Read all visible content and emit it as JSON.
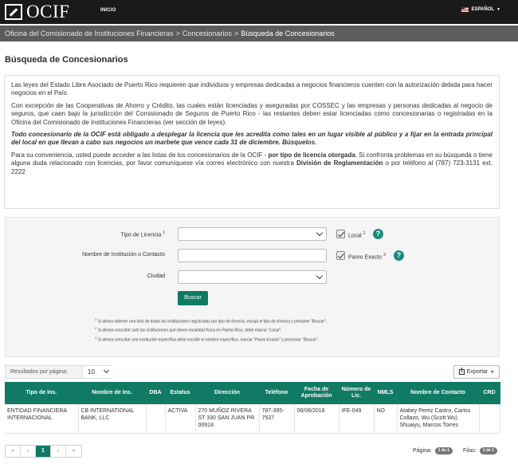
{
  "header": {
    "logo_text": "OCIF",
    "nav_home": "INICIO",
    "language": "ESPAÑOL"
  },
  "breadcrumb": {
    "items": [
      "Oficina del Comisionado de Instituciones Financieras",
      "Concesionarios"
    ],
    "current": "Búsqueda de Concesionarios",
    "separator": ">"
  },
  "page_title": "Búsqueda de Concesionarios",
  "info": {
    "p1": "Las leyes del Estado Libre Asociado de Puerto Rico requieren que individuos y empresas dedicadas a negocios financieros cuenten con la autorización debida para hacer negocios en el País.",
    "p2": "Con excepción de las Cooperativas de Ahorro y Crédito, las cuales están licenciadas y aseguradas por COSSEC y las empresas y personas dedicadas al negocio de seguros, que caen bajo la jurisdicción del Comisionado de Seguros de Puerto Rico - las restantes deben estar licenciadas como concesionarias o registradas en la Oficina del Comisionado de Instituciones Financieras (ver sección de leyes).",
    "p3": "Todo concesionario de la OCIF está obligado a desplegar la licencia que les acredita como tales en un lugar visible al público y a fijar en la entrada principal del local en que llevan a cabo sus negocios un marbete que vence cada 31 de diciembre. Búsquelos.",
    "p4a": "Para su conveniencia, usted puede acceder a las listas de los concesionarios de la OCIF - ",
    "p4b": "por tipo de licencia otorgada",
    "p4c": ". Si confronta problemas en su búsqueda o tiene alguna duda relacionado con licencias, por favor comuníquese vía correo electrónico con nuestra ",
    "p4d": "División de Reglamentación",
    "p4e": " o por teléfono al (787) 723-3131 ext. 2222"
  },
  "form": {
    "tipo_label": "Tipo de Licencia",
    "tipo_sup": "1",
    "tipo_value": "",
    "nombre_label": "Nombre de Institución o Contacto",
    "nombre_value": "",
    "ciudad_label": "Ciudad",
    "ciudad_value": "",
    "local_label": "Local",
    "local_sup": "2",
    "local_checked": true,
    "pareo_label": "Pareo Exacto",
    "pareo_sup": "3",
    "pareo_checked": true,
    "help_glyph": "?",
    "search_button": "Buscar",
    "notes": [
      {
        "sup": "1",
        "text": "Si desea obtener una lista de todas las instituciones registradas por tipo de licencia, escoja el tipo de licencia y presione \"Buscar\"."
      },
      {
        "sup": "2",
        "text": "Si desea consultar solo las instituciones que tienen localidad física en Puerto Rico, debe marcar \"Local\"."
      },
      {
        "sup": "3",
        "text": "Si desea consultar una institución específica debe escribir el nombre específico, marcar \"Pareo Exacto\" y presionar \"Buscar\"."
      }
    ]
  },
  "results": {
    "per_page_label": "Resultados por página:",
    "per_page_value": "10",
    "export_label": "Exportar",
    "columns": [
      "Tipo de Ins.",
      "Nombre de Ins.",
      "DBA",
      "Estatus",
      "Dirección",
      "Teléfono",
      "Fecha de Aprobación",
      "Número de Lic.",
      "NMLS",
      "Nombre de Contacto",
      "CRD"
    ],
    "rows": [
      [
        "ENTIDAD FINANCIERA INTERNACIONAL",
        "CB INTERNATIONAL BANK, LLC",
        "",
        "ACTIVA",
        "270 MUÑOZ RIVERA ST 330 SAN JUAN PR 00918",
        "787-395-7537",
        "06/08/2018",
        "IFE-049",
        "NO",
        "Atabey Perez Castro, Carlos Collazo, Wu (Scott Wu) Shuaiyu, Marcos Torres",
        ""
      ]
    ]
  },
  "pagination": {
    "first": "«",
    "prev": "‹",
    "current": "1",
    "next": "›",
    "last": "»",
    "page_label": "Página:",
    "page_value": "1 de 1",
    "rows_label": "Filas:",
    "rows_value": "1 de 1"
  },
  "colors": {
    "accent": "#117a65",
    "topbar": "#1a1a1a",
    "breadcrumb_bg": "#5c5c5c"
  },
  "icons": {
    "search": "help-circle-icon",
    "export": "export-icon"
  }
}
